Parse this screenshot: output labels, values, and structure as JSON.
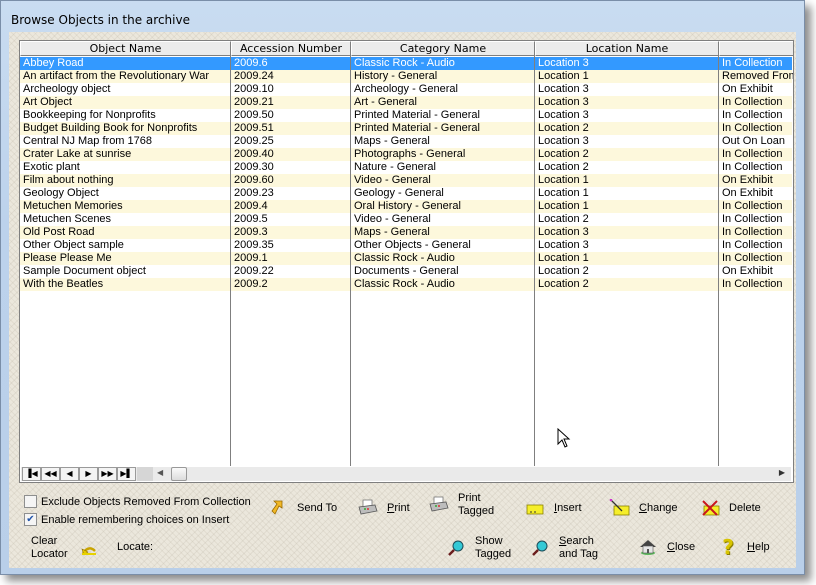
{
  "window": {
    "title": "Browse Objects in the archive"
  },
  "grid": {
    "columns": [
      "Object Name",
      "Accession Number",
      "Category Name",
      "Location Name",
      ""
    ],
    "selected_row": 0,
    "rows": [
      [
        "Abbey Road",
        "2009.6",
        "Classic Rock - Audio",
        "Location 3",
        "In Collection"
      ],
      [
        "An artifact from the Revolutionary War",
        "2009.24",
        "History - General",
        "Location 1",
        "Removed From"
      ],
      [
        "Archeology object",
        "2009.10",
        "Archeology - General",
        "Location 3",
        "On Exhibit"
      ],
      [
        "Art Object",
        "2009.21",
        "Art - General",
        "Location 3",
        "In Collection"
      ],
      [
        "Bookkeeping for Nonprofits",
        "2009.50",
        "Printed Material - General",
        "Location 3",
        "In Collection"
      ],
      [
        "Budget Building Book for Nonprofits",
        "2009.51",
        "Printed Material - General",
        "Location 2",
        "In Collection"
      ],
      [
        "Central NJ Map from 1768",
        "2009.25",
        "Maps - General",
        "Location 3",
        "Out On Loan"
      ],
      [
        "Crater Lake at sunrise",
        "2009.40",
        "Photographs - General",
        "Location 2",
        "In Collection"
      ],
      [
        "Exotic plant",
        "2009.30",
        "Nature - General",
        "Location 2",
        "In Collection"
      ],
      [
        "Film about nothing",
        "2009.60",
        "Video - General",
        "Location 1",
        "On Exhibit"
      ],
      [
        "Geology Object",
        "2009.23",
        "Geology - General",
        "Location 1",
        "On Exhibit"
      ],
      [
        "Metuchen Memories",
        "2009.4",
        "Oral History - General",
        "Location 1",
        "In Collection"
      ],
      [
        "Metuchen Scenes",
        "2009.5",
        "Video - General",
        "Location 2",
        "In Collection"
      ],
      [
        "Old Post Road",
        "2009.3",
        "Maps - General",
        "Location 3",
        "In Collection"
      ],
      [
        "Other Object sample",
        "2009.35",
        "Other Objects - General",
        "Location 3",
        "In Collection"
      ],
      [
        "Please Please Me",
        "2009.1",
        "Classic Rock - Audio",
        "Location 1",
        "In Collection"
      ],
      [
        "Sample Document object",
        "2009.22",
        "Documents - General",
        "Location 2",
        "On Exhibit"
      ],
      [
        "With the Beatles",
        "2009.2",
        "Classic Rock - Audio",
        "Location 2",
        "In Collection"
      ]
    ],
    "navigator": {
      "first": "first-record",
      "prior_page": "prior-page",
      "prior": "prior-record",
      "next": "next-record",
      "next_page": "next-page",
      "last": "last-record"
    }
  },
  "options": {
    "exclude_removed": {
      "label": "Exclude Objects Removed From Collection",
      "checked": false
    },
    "remember_choices": {
      "label": "Enable remembering choices on Insert",
      "checked": true
    }
  },
  "locator": {
    "clear_line1": "Clear",
    "clear_line2": "Locator",
    "locate_label": "Locate:",
    "locate_value": ""
  },
  "buttons": {
    "send_to": "Send To",
    "print": "Print",
    "print_tagged_1": "Print",
    "print_tagged_2": "Tagged",
    "insert": "Insert",
    "change": "Change",
    "delete": "Delete",
    "show_tagged_1": "Show",
    "show_tagged_2": "Tagged",
    "search_tag_1": "Search",
    "search_tag_2": "and Tag",
    "close": "Close",
    "help": "Help"
  },
  "colors": {
    "selection": "#3399ff",
    "alt_row": "#fdf8dc",
    "window_frame": "#bcd2ec"
  }
}
